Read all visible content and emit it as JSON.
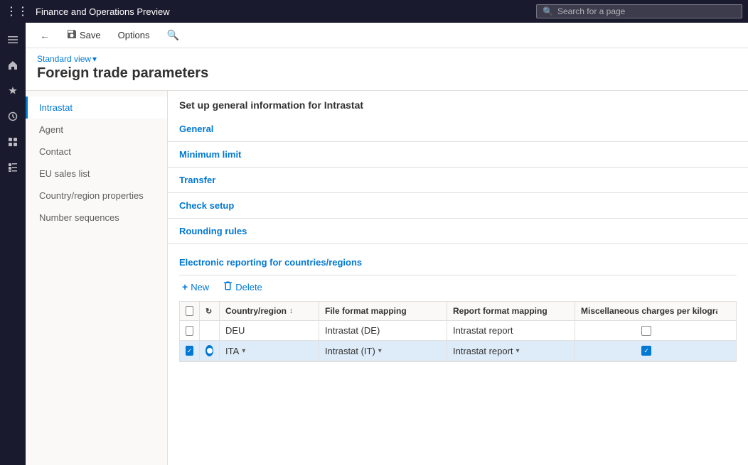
{
  "app": {
    "title": "Finance and Operations Preview",
    "search_placeholder": "Search for a page"
  },
  "toolbar": {
    "back_label": "",
    "save_label": "Save",
    "options_label": "Options",
    "search_label": ""
  },
  "page": {
    "view_label": "Standard view",
    "title": "Foreign trade parameters"
  },
  "left_nav": {
    "icons": [
      "grid",
      "home",
      "star",
      "clock",
      "bookmark",
      "list"
    ]
  },
  "sidebar": {
    "items": [
      {
        "id": "intrastat",
        "label": "Intrastat",
        "active": true
      },
      {
        "id": "agent",
        "label": "Agent",
        "active": false
      },
      {
        "id": "contact",
        "label": "Contact",
        "active": false
      },
      {
        "id": "eu-sales",
        "label": "EU sales list",
        "active": false
      },
      {
        "id": "country-region",
        "label": "Country/region properties",
        "active": false
      },
      {
        "id": "number-sequences",
        "label": "Number sequences",
        "active": false
      }
    ]
  },
  "content": {
    "intrastat_description": "Set up general information for Intrastat",
    "sections": [
      {
        "id": "general",
        "label": "General"
      },
      {
        "id": "minimum-limit",
        "label": "Minimum limit"
      },
      {
        "id": "transfer",
        "label": "Transfer"
      },
      {
        "id": "check-setup",
        "label": "Check setup"
      },
      {
        "id": "rounding-rules",
        "label": "Rounding rules"
      }
    ],
    "er_section": {
      "title": "Electronic reporting for countries/regions",
      "table_toolbar": {
        "new_label": "New",
        "delete_label": "Delete"
      },
      "table": {
        "columns": [
          {
            "id": "select",
            "label": ""
          },
          {
            "id": "edit",
            "label": ""
          },
          {
            "id": "country_region",
            "label": "Country/region",
            "sortable": true
          },
          {
            "id": "file_format",
            "label": "File format mapping"
          },
          {
            "id": "report_format",
            "label": "Report format mapping"
          },
          {
            "id": "misc_charges",
            "label": "Miscellaneous charges per kilogram"
          }
        ],
        "rows": [
          {
            "id": "row1",
            "selected": false,
            "editing": false,
            "country_region": "DEU",
            "file_format": "Intrastat (DE)",
            "report_format": "Intrastat report",
            "misc_charges_checked": false
          },
          {
            "id": "row2",
            "selected": true,
            "editing": true,
            "country_region": "ITA",
            "file_format": "Intrastat (IT)",
            "report_format": "Intrastat report",
            "misc_charges_checked": true
          }
        ]
      }
    }
  }
}
